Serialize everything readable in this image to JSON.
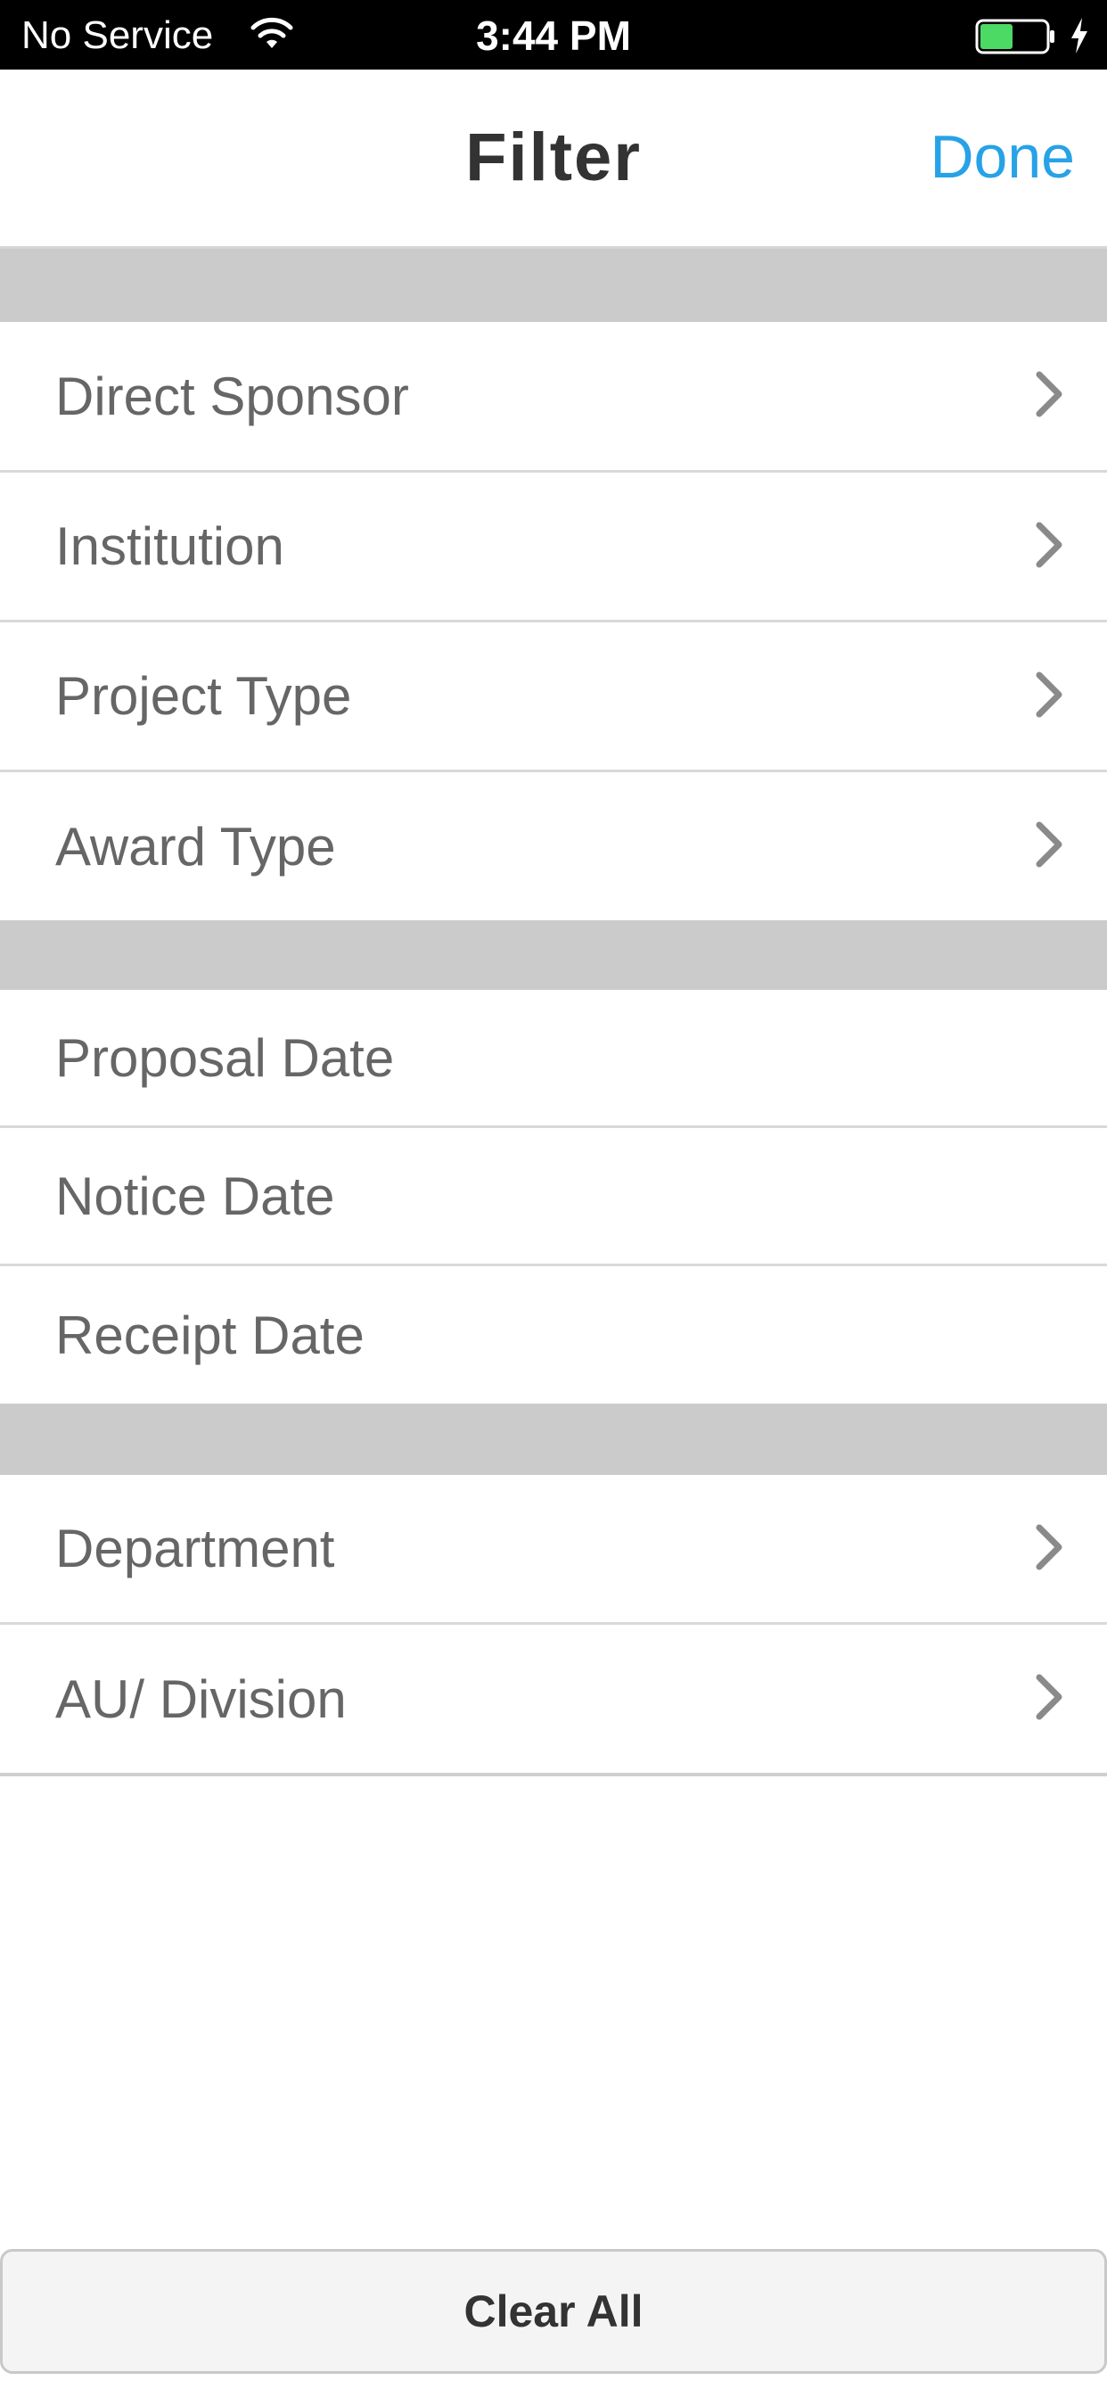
{
  "status_bar": {
    "carrier": "No Service",
    "time": "3:44 PM",
    "battery_color": "#4cd964"
  },
  "nav": {
    "title": "Filter",
    "done_label": "Done",
    "accent_color": "#27a2e6"
  },
  "sections": [
    {
      "items": [
        {
          "label": "Direct Sponsor",
          "disclosure": true
        },
        {
          "label": "Institution",
          "disclosure": true
        },
        {
          "label": "Project Type",
          "disclosure": true
        },
        {
          "label": "Award Type",
          "disclosure": true
        }
      ]
    },
    {
      "items": [
        {
          "label": "Proposal Date",
          "disclosure": false
        },
        {
          "label": "Notice Date",
          "disclosure": false
        },
        {
          "label": "Receipt Date",
          "disclosure": false
        }
      ]
    },
    {
      "items": [
        {
          "label": "Department",
          "disclosure": true
        },
        {
          "label": "AU/ Division",
          "disclosure": true
        }
      ]
    }
  ],
  "footer": {
    "clear_all_label": "Clear All"
  },
  "icons": {
    "wifi": "wifi-icon",
    "battery": "battery-icon",
    "charging": "charging-bolt-icon",
    "disclosure": "chevron-right-icon"
  }
}
